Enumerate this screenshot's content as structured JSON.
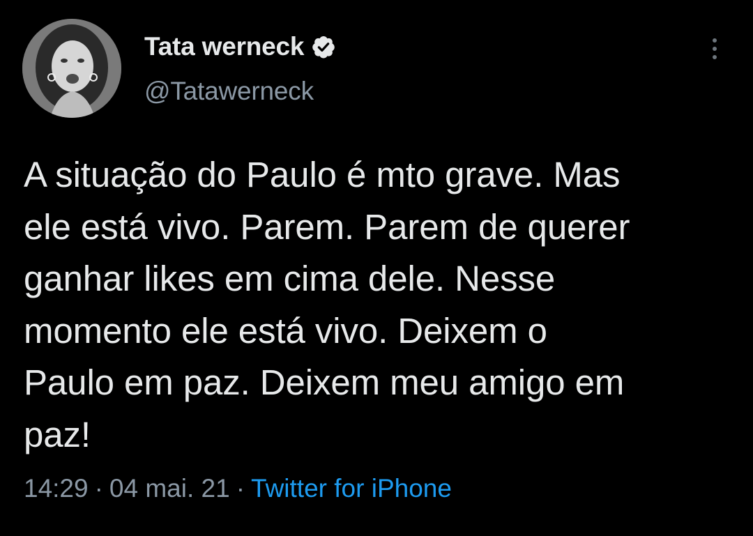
{
  "tweet": {
    "author": {
      "display_name": "Tata werneck",
      "handle": "@Tatawerneck",
      "verified": true,
      "avatar_icon": "profile-photo"
    },
    "more_icon": "more-vertical-icon",
    "text": "A situação do Paulo é mto grave. Mas\nele está vivo. Parem. Parem de querer\nganhar likes em cima dele. Nesse\nmomento ele está vivo. Deixem o\nPaulo em paz. Deixem meu amigo em\npaz!",
    "time": "14:29",
    "date": "04 mai. 21",
    "separator": "·",
    "source": "Twitter for iPhone"
  },
  "colors": {
    "background": "#000000",
    "text": "#e7e9ea",
    "secondary": "#8b98a5",
    "link": "#1d9bf0"
  }
}
